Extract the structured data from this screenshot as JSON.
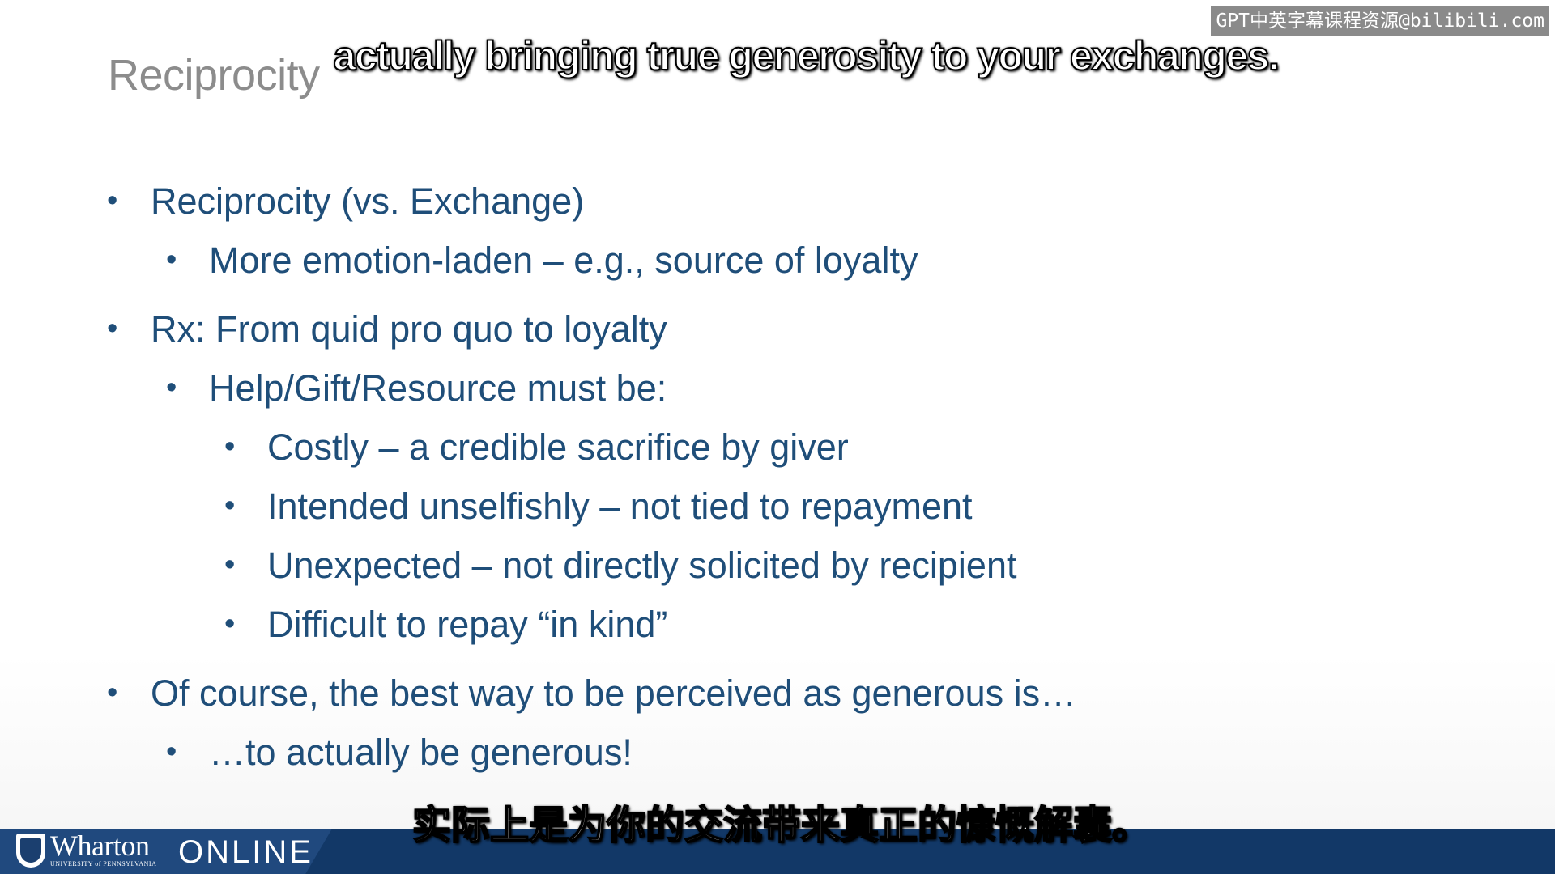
{
  "watermark": "GPT中英字幕课程资源@bilibili.com",
  "slide": {
    "title": "Reciprocity",
    "bullets": [
      {
        "level": 1,
        "text": "Reciprocity (vs. Exchange)"
      },
      {
        "level": 2,
        "text": "More emotion-laden – e.g., source of loyalty"
      },
      {
        "level": 1,
        "text": "Rx: From quid pro quo to loyalty"
      },
      {
        "level": 2,
        "text": "Help/Gift/Resource must be:"
      },
      {
        "level": 3,
        "text": "Costly – a credible sacrifice by giver"
      },
      {
        "level": 3,
        "text": "Intended unselfishly – not tied to repayment"
      },
      {
        "level": 3,
        "text": "Unexpected – not directly solicited by recipient"
      },
      {
        "level": 3,
        "text": "Difficult to repay “in kind”"
      },
      {
        "level": 1,
        "text": "Of course, the best way to be perceived as generous is…"
      },
      {
        "level": 2,
        "text": "…to actually be generous!"
      }
    ],
    "bullet_symbol": "•"
  },
  "subtitles": {
    "english": "actually bringing true generosity to your exchanges.",
    "chinese": "实际上是为你的交流带来真正的慷慨解囊。"
  },
  "footer": {
    "logo_text": "Wharton",
    "logo_subtext": "UNIVERSITY of PENNSYLVANIA",
    "online_label": "ONLINE",
    "logo_icon": "university-shield-icon"
  },
  "colors": {
    "title": "#8c8c8c",
    "bullet_text": "#1f4e79",
    "footer_bar": "#123867",
    "footer_logo_panel": "#20497e",
    "watermark_bg": "#8a8a8a"
  }
}
